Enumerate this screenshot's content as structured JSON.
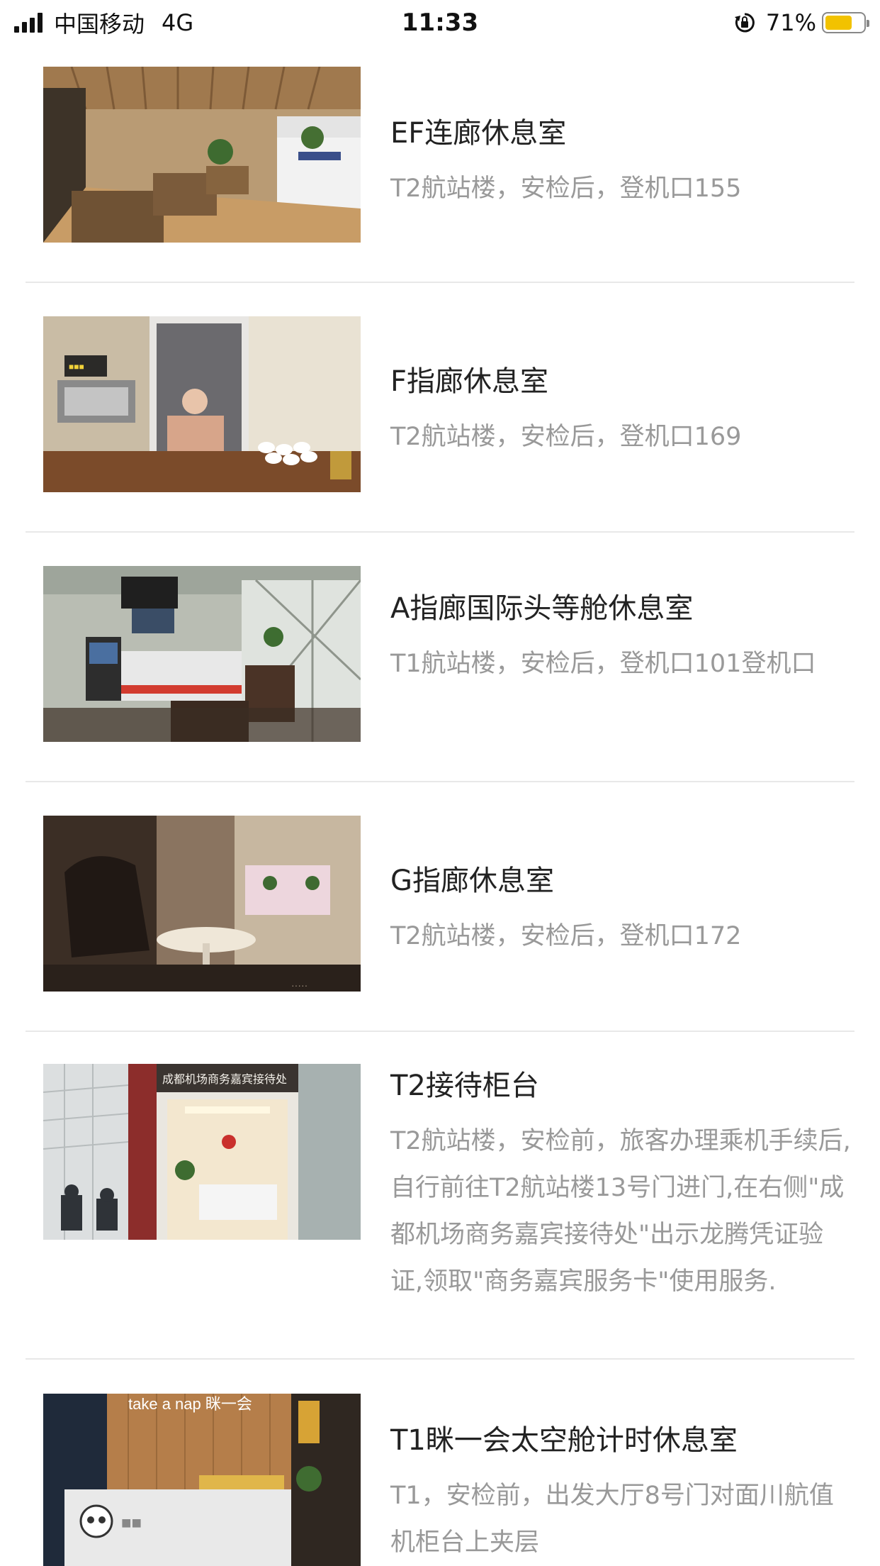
{
  "status_bar": {
    "carrier": "中国移动",
    "network": "4G",
    "time": "11:33",
    "battery_percent": "71%",
    "battery_level": 0.71,
    "battery_color": "#f2c200"
  },
  "lounges": [
    {
      "title": "EF连廊休息室",
      "desc": "T2航站楼，安检后，登机口155",
      "image": "lounge-seating-photo"
    },
    {
      "title": "F指廊休息室",
      "desc": "T2航站楼，安检后，登机口169",
      "image": "coffee-machine-fridge-photo"
    },
    {
      "title": "A指廊国际头等舱休息室",
      "desc": "T1航站楼，安检后，登机口101登机口",
      "image": "buffet-counter-photo"
    },
    {
      "title": "G指廊休息室",
      "desc": "T2航站楼，安检后，登机口172",
      "image": "armchair-table-photo"
    },
    {
      "title": "T2接待柜台",
      "desc": "T2航站楼，安检前，旅客办理乘机手续后,自行前往T2航站楼13号门进门,在右侧\"成都机场商务嘉宾接待处\"出示龙腾凭证验证,领取\"商务嘉宾服务卡\"使用服务.",
      "image": "reception-desk-photo",
      "sign_text": "成都机场商务嘉宾接待处"
    },
    {
      "title": "T1眯一会太空舱计时休息室",
      "desc": "T1，安检前，出发大厅8号门对面川航值机柜台上夹层",
      "image": "take-a-nap-photo",
      "sign_text": "take a nap 眯一会"
    }
  ]
}
